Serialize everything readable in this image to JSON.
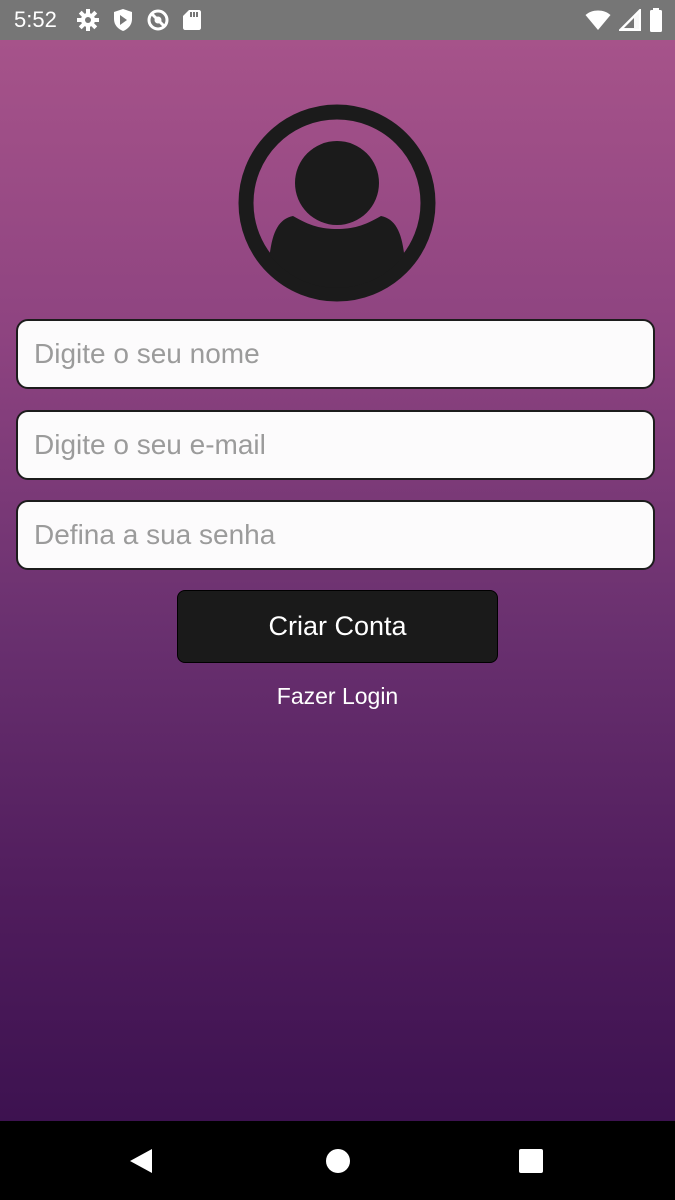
{
  "status_bar": {
    "time": "5:52",
    "left_icons": [
      "gear-icon",
      "shield-play-icon",
      "do-not-disturb-icon",
      "sd-card-icon"
    ],
    "right_icons": [
      "wifi-icon",
      "cell-signal-icon",
      "battery-icon"
    ]
  },
  "form": {
    "name_placeholder": "Digite o seu nome",
    "email_placeholder": "Digite o seu e-mail",
    "password_placeholder": "Defina a sua senha",
    "create_account_label": "Criar Conta",
    "login_link_label": "Fazer Login"
  },
  "colors": {
    "background_top": "#a6538a",
    "background_bottom": "#3d1250",
    "button": "#1a1a1a",
    "field_background": "#fcfbfc"
  },
  "nav_bar": {
    "buttons": [
      "back-icon",
      "home-icon",
      "recents-icon"
    ]
  }
}
